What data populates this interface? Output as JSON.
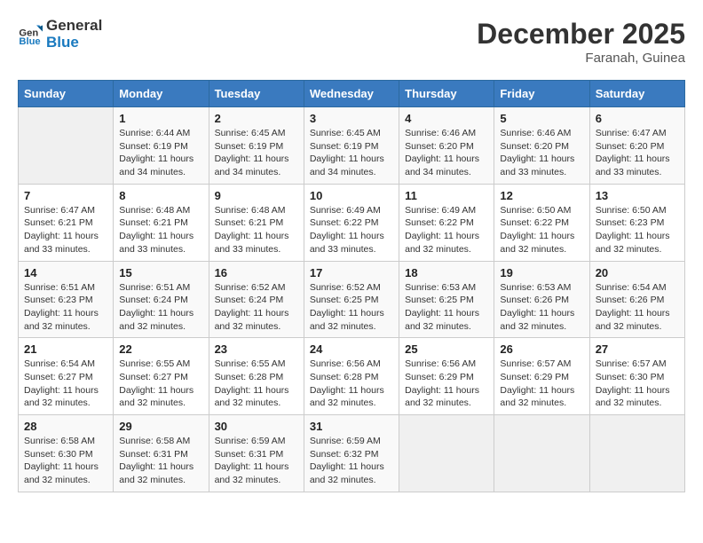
{
  "logo": {
    "line1": "General",
    "line2": "Blue"
  },
  "title": "December 2025",
  "location": "Faranah, Guinea",
  "days_header": [
    "Sunday",
    "Monday",
    "Tuesday",
    "Wednesday",
    "Thursday",
    "Friday",
    "Saturday"
  ],
  "weeks": [
    [
      {
        "day": "",
        "info": ""
      },
      {
        "day": "1",
        "info": "Sunrise: 6:44 AM\nSunset: 6:19 PM\nDaylight: 11 hours and 34 minutes."
      },
      {
        "day": "2",
        "info": "Sunrise: 6:45 AM\nSunset: 6:19 PM\nDaylight: 11 hours and 34 minutes."
      },
      {
        "day": "3",
        "info": "Sunrise: 6:45 AM\nSunset: 6:19 PM\nDaylight: 11 hours and 34 minutes."
      },
      {
        "day": "4",
        "info": "Sunrise: 6:46 AM\nSunset: 6:20 PM\nDaylight: 11 hours and 34 minutes."
      },
      {
        "day": "5",
        "info": "Sunrise: 6:46 AM\nSunset: 6:20 PM\nDaylight: 11 hours and 33 minutes."
      },
      {
        "day": "6",
        "info": "Sunrise: 6:47 AM\nSunset: 6:20 PM\nDaylight: 11 hours and 33 minutes."
      }
    ],
    [
      {
        "day": "7",
        "info": "Sunrise: 6:47 AM\nSunset: 6:21 PM\nDaylight: 11 hours and 33 minutes."
      },
      {
        "day": "8",
        "info": "Sunrise: 6:48 AM\nSunset: 6:21 PM\nDaylight: 11 hours and 33 minutes."
      },
      {
        "day": "9",
        "info": "Sunrise: 6:48 AM\nSunset: 6:21 PM\nDaylight: 11 hours and 33 minutes."
      },
      {
        "day": "10",
        "info": "Sunrise: 6:49 AM\nSunset: 6:22 PM\nDaylight: 11 hours and 33 minutes."
      },
      {
        "day": "11",
        "info": "Sunrise: 6:49 AM\nSunset: 6:22 PM\nDaylight: 11 hours and 32 minutes."
      },
      {
        "day": "12",
        "info": "Sunrise: 6:50 AM\nSunset: 6:22 PM\nDaylight: 11 hours and 32 minutes."
      },
      {
        "day": "13",
        "info": "Sunrise: 6:50 AM\nSunset: 6:23 PM\nDaylight: 11 hours and 32 minutes."
      }
    ],
    [
      {
        "day": "14",
        "info": "Sunrise: 6:51 AM\nSunset: 6:23 PM\nDaylight: 11 hours and 32 minutes."
      },
      {
        "day": "15",
        "info": "Sunrise: 6:51 AM\nSunset: 6:24 PM\nDaylight: 11 hours and 32 minutes."
      },
      {
        "day": "16",
        "info": "Sunrise: 6:52 AM\nSunset: 6:24 PM\nDaylight: 11 hours and 32 minutes."
      },
      {
        "day": "17",
        "info": "Sunrise: 6:52 AM\nSunset: 6:25 PM\nDaylight: 11 hours and 32 minutes."
      },
      {
        "day": "18",
        "info": "Sunrise: 6:53 AM\nSunset: 6:25 PM\nDaylight: 11 hours and 32 minutes."
      },
      {
        "day": "19",
        "info": "Sunrise: 6:53 AM\nSunset: 6:26 PM\nDaylight: 11 hours and 32 minutes."
      },
      {
        "day": "20",
        "info": "Sunrise: 6:54 AM\nSunset: 6:26 PM\nDaylight: 11 hours and 32 minutes."
      }
    ],
    [
      {
        "day": "21",
        "info": "Sunrise: 6:54 AM\nSunset: 6:27 PM\nDaylight: 11 hours and 32 minutes."
      },
      {
        "day": "22",
        "info": "Sunrise: 6:55 AM\nSunset: 6:27 PM\nDaylight: 11 hours and 32 minutes."
      },
      {
        "day": "23",
        "info": "Sunrise: 6:55 AM\nSunset: 6:28 PM\nDaylight: 11 hours and 32 minutes."
      },
      {
        "day": "24",
        "info": "Sunrise: 6:56 AM\nSunset: 6:28 PM\nDaylight: 11 hours and 32 minutes."
      },
      {
        "day": "25",
        "info": "Sunrise: 6:56 AM\nSunset: 6:29 PM\nDaylight: 11 hours and 32 minutes."
      },
      {
        "day": "26",
        "info": "Sunrise: 6:57 AM\nSunset: 6:29 PM\nDaylight: 11 hours and 32 minutes."
      },
      {
        "day": "27",
        "info": "Sunrise: 6:57 AM\nSunset: 6:30 PM\nDaylight: 11 hours and 32 minutes."
      }
    ],
    [
      {
        "day": "28",
        "info": "Sunrise: 6:58 AM\nSunset: 6:30 PM\nDaylight: 11 hours and 32 minutes."
      },
      {
        "day": "29",
        "info": "Sunrise: 6:58 AM\nSunset: 6:31 PM\nDaylight: 11 hours and 32 minutes."
      },
      {
        "day": "30",
        "info": "Sunrise: 6:59 AM\nSunset: 6:31 PM\nDaylight: 11 hours and 32 minutes."
      },
      {
        "day": "31",
        "info": "Sunrise: 6:59 AM\nSunset: 6:32 PM\nDaylight: 11 hours and 32 minutes."
      },
      {
        "day": "",
        "info": ""
      },
      {
        "day": "",
        "info": ""
      },
      {
        "day": "",
        "info": ""
      }
    ]
  ]
}
